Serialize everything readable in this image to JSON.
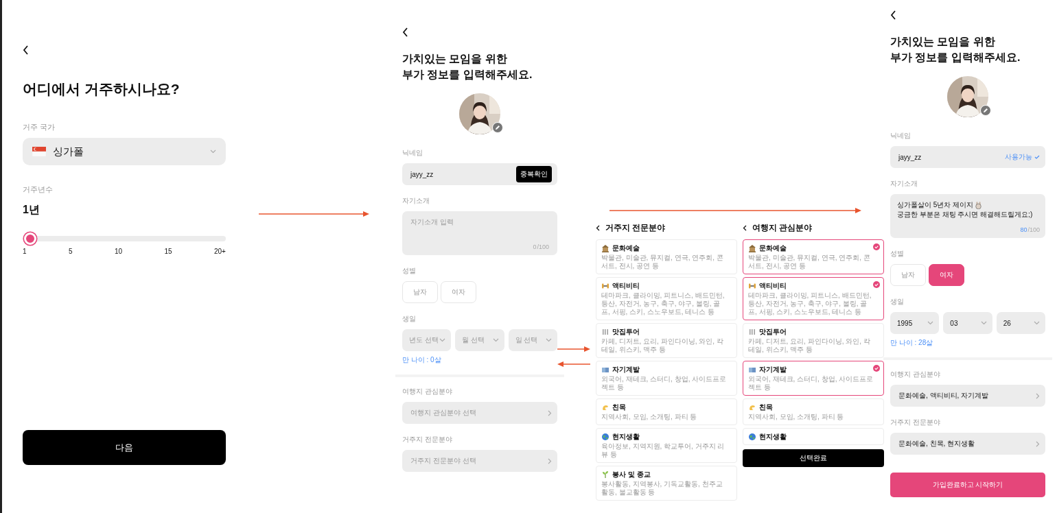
{
  "residence": {
    "title": "어디에서 거주하시나요?",
    "country": {
      "label": "거주 국가",
      "value": "싱가폴"
    },
    "years": {
      "label": "거주년수",
      "value": "1년",
      "level": 0,
      "ticks": [
        "1",
        "5",
        "10",
        "15",
        "20+"
      ]
    },
    "next_button": "다음"
  },
  "profile_before": {
    "title_lines": [
      "가치있는 모임을 위한",
      "부가 정보를 입력해주세요."
    ],
    "nickname": {
      "label": "닉네임",
      "value": "jayy_zz",
      "action": "중복확인"
    },
    "intro": {
      "label": "자기소개",
      "placeholder": "자기소개 입력",
      "count": "0",
      "max": "/100"
    },
    "gender": {
      "label": "성별",
      "options": [
        {
          "label": "남자",
          "selected": false
        },
        {
          "label": "여자",
          "selected": false
        }
      ]
    },
    "birthday": {
      "label": "생일",
      "fields": [
        {
          "placeholder": "년도 선택"
        },
        {
          "placeholder": "월 선택"
        },
        {
          "placeholder": "일 선택"
        }
      ],
      "age": "만 나이 : 0살"
    },
    "travel_interest": {
      "label": "여행지 관심분야",
      "placeholder": "여행지 관심분야 선택"
    },
    "residence_expertise": {
      "label": "거주지 전문분야",
      "placeholder": "거주지 전문분야 선택"
    }
  },
  "expertise_picker": {
    "title": "거주지 전문분야",
    "items": [
      {
        "name": "문화예술",
        "description": "박물관, 미술관, 뮤지컬, 연극, 연주회, 콘서트, 전시, 공연 등",
        "selected": false
      },
      {
        "name": "액티비티",
        "description": "테마파크, 클라이밍, 피트니스, 배드민턴, 등산, 자전거, 농구, 축구, 야구, 볼링, 골프, 서핑, 스키, 스노우보드, 테니스 등",
        "selected": false
      },
      {
        "name": "맛집투어",
        "description": "카페, 디저트, 요리, 파인다이닝, 와인, 칵테일, 위스키, 맥주 등",
        "selected": false
      },
      {
        "name": "자기계발",
        "description": "외국어, 재테크, 스터디, 창업, 사이드프로젝트 등",
        "selected": false
      },
      {
        "name": "친목",
        "description": "지역사회, 모임, 소개팅, 파티 등",
        "selected": false
      },
      {
        "name": "현지생활",
        "description": "육아정보, 지역지원, 학교투어, 거주지 리뷰 등",
        "selected": false
      },
      {
        "name": "봉사 및 종교",
        "description": "봉사활동, 지역봉사, 기독교활동, 천주교활동, 불교활동 등",
        "selected": false
      }
    ]
  },
  "interest_picker": {
    "title": "여행지 관심분야",
    "items": [
      {
        "name": "문화예술",
        "description": "박물관, 미술관, 뮤지컬, 연극, 연주회, 콘서트, 전시, 공연 등",
        "selected": true
      },
      {
        "name": "액티비티",
        "description": "테마파크, 클라이밍, 피트니스, 배드민턴, 등산, 자전거, 농구, 축구, 야구, 볼링, 골프, 서핑, 스키, 스노우보드, 테니스 등",
        "selected": true
      },
      {
        "name": "맛집투어",
        "description": "카페, 디저트, 요리, 파인다이닝, 와인, 칵테일, 위스키, 맥주 등",
        "selected": false
      },
      {
        "name": "자기계발",
        "description": "외국어, 재테크, 스터디, 창업, 사이드프로젝트 등",
        "selected": true
      },
      {
        "name": "친목",
        "description": "지역사회, 모임, 소개팅, 파티 등",
        "selected": false
      },
      {
        "name": "현지생활",
        "selected": false
      }
    ],
    "button": "선택완료"
  },
  "profile_after": {
    "title_lines": [
      "가치있는 모임을 위한",
      "부가 정보를 입력해주세요."
    ],
    "nickname": {
      "label": "닉네임",
      "value": "jayy_zz",
      "status": "사용가능"
    },
    "intro": {
      "label": "자기소개",
      "lines": [
        "싱가폴살이 5년차 제이지",
        "궁금한 부분은 채팅 주시면 해결해드릴게요;)"
      ],
      "count": "80",
      "max": "/100"
    },
    "gender": {
      "label": "성별",
      "options": [
        {
          "label": "남자",
          "selected": false
        },
        {
          "label": "여자",
          "selected": true
        }
      ]
    },
    "birthday": {
      "label": "생일",
      "fields": [
        {
          "value": "1995"
        },
        {
          "value": "03"
        },
        {
          "value": "26"
        }
      ],
      "age": "만 나이 : 28살"
    },
    "travel_interest": {
      "label": "여행지 관심분야",
      "value": "문화예술, 액티비티, 자기계발"
    },
    "residence_expertise": {
      "label": "거주지 전문분야",
      "value": "문화예술, 친목, 현지생활"
    },
    "submit_button": "가입완료하고 시작하기"
  }
}
